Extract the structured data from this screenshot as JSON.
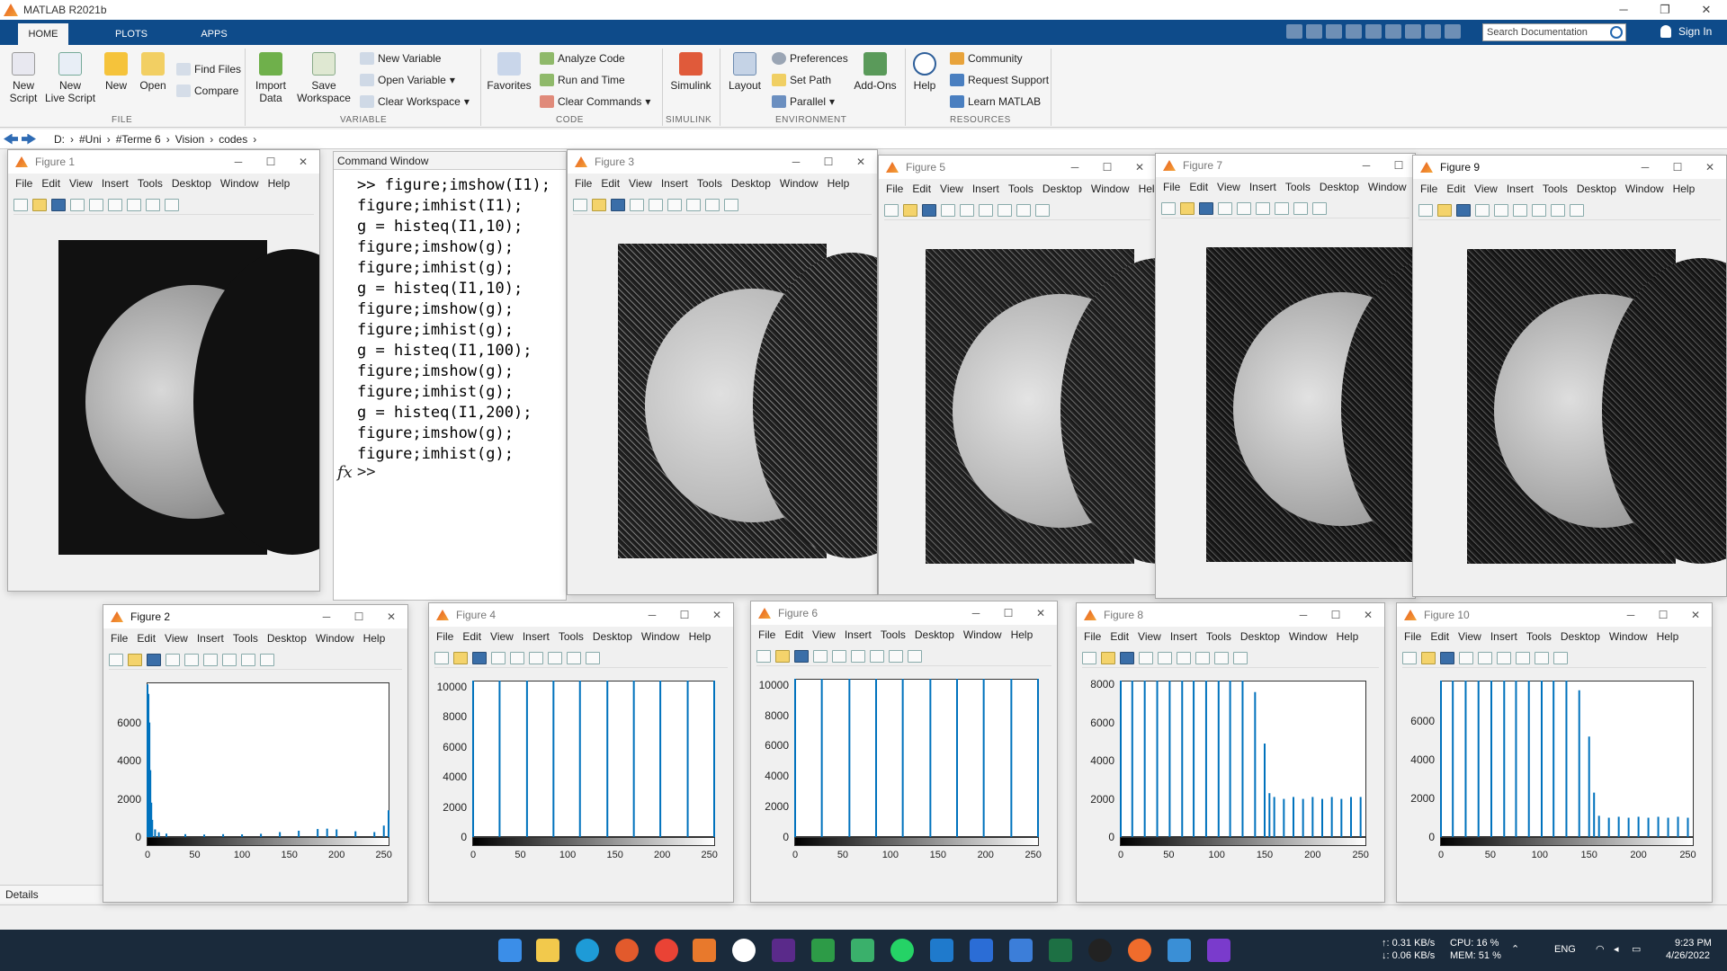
{
  "window": {
    "title": "MATLAB R2021b"
  },
  "tabs": [
    {
      "label": "HOME"
    },
    {
      "label": "PLOTS"
    },
    {
      "label": "APPS"
    }
  ],
  "search": {
    "placeholder": "Search Documentation"
  },
  "account": {
    "label": "Sign In"
  },
  "ribbon": {
    "file": {
      "label": "FILE",
      "new_script": "New\nScript",
      "new_live_script": "New\nLive Script",
      "new": "New",
      "open": "Open",
      "find_files": "Find Files",
      "compare": "Compare"
    },
    "variable": {
      "label": "VARIABLE",
      "import_data": "Import\nData",
      "save_workspace": "Save\nWorkspace",
      "new_variable": "New Variable",
      "open_variable": "Open Variable",
      "clear_workspace": "Clear Workspace"
    },
    "code": {
      "label": "CODE",
      "favorites": "Favorites",
      "analyze_code": "Analyze Code",
      "run_and_time": "Run and Time",
      "clear_commands": "Clear Commands"
    },
    "simulink": {
      "label": "SIMULINK",
      "simulink": "Simulink"
    },
    "environment": {
      "label": "ENVIRONMENT",
      "layout": "Layout",
      "preferences": "Preferences",
      "set_path": "Set Path",
      "parallel": "Parallel",
      "add_ons": "Add-Ons"
    },
    "resources": {
      "label": "RESOURCES",
      "help": "Help",
      "community": "Community",
      "request_support": "Request Support",
      "learn_matlab": "Learn MATLAB"
    }
  },
  "path": [
    "D:",
    "#Uni",
    "#Terme 6",
    "Vision",
    "codes"
  ],
  "command_window": {
    "title": "Command Window",
    "lines": [
      ">> figure;imshow(I1);",
      "figure;imhist(I1);",
      "g = histeq(I1,10);",
      "figure;imshow(g);",
      "figure;imhist(g);",
      "g = histeq(I1,10);",
      "figure;imshow(g);",
      "figure;imhist(g);",
      "g = histeq(I1,100);",
      "figure;imshow(g);",
      "figure;imhist(g);",
      "g = histeq(I1,200);",
      "figure;imshow(g);",
      "figure;imhist(g);"
    ],
    "fx": "fx",
    "prompt": ">>"
  },
  "details": {
    "label": "Details"
  },
  "figure_menu": [
    "File",
    "Edit",
    "View",
    "Insert",
    "Tools",
    "Desktop",
    "Window",
    "Help"
  ],
  "figures": {
    "fig1": {
      "title": "Figure 1"
    },
    "fig3": {
      "title": "Figure 3"
    },
    "fig5": {
      "title": "Figure 5"
    },
    "fig7": {
      "title": "Figure 7"
    },
    "fig9": {
      "title": "Figure 9"
    },
    "fig2": {
      "title": "Figure 2"
    },
    "fig4": {
      "title": "Figure 4"
    },
    "fig6": {
      "title": "Figure 6"
    },
    "fig8": {
      "title": "Figure 8"
    },
    "fig10": {
      "title": "Figure 10"
    }
  },
  "chart_data": [
    {
      "figure": "Figure 2",
      "type": "bar",
      "description_kind": "histogram",
      "x_ticks": [
        0,
        50,
        100,
        150,
        200,
        250
      ],
      "y_ticks": [
        0,
        2000,
        4000,
        6000
      ],
      "xlim": [
        0,
        255
      ],
      "ylim": [
        0,
        8100
      ],
      "x": [
        0,
        1,
        2,
        3,
        4,
        5,
        8,
        12,
        20,
        40,
        60,
        80,
        100,
        120,
        140,
        160,
        180,
        190,
        200,
        220,
        240,
        250,
        255
      ],
      "values": [
        8000,
        7500,
        6000,
        3500,
        1800,
        900,
        400,
        250,
        180,
        150,
        130,
        150,
        140,
        170,
        260,
        330,
        420,
        440,
        400,
        300,
        260,
        600,
        1400
      ],
      "color": "#0072bd"
    },
    {
      "figure": "Figure 4",
      "type": "bar",
      "description_kind": "histogram",
      "x_ticks": [
        0,
        50,
        100,
        150,
        200,
        250
      ],
      "y_ticks": [
        0,
        2000,
        4000,
        6000,
        8000,
        10000
      ],
      "xlim": [
        0,
        255
      ],
      "ylim": [
        0,
        10400
      ],
      "x": [
        0,
        28,
        57,
        85,
        113,
        142,
        170,
        198,
        227,
        255
      ],
      "values": [
        10400,
        10400,
        10400,
        10400,
        10400,
        10400,
        10400,
        10400,
        10400,
        10400
      ],
      "color": "#0072bd"
    },
    {
      "figure": "Figure 6",
      "type": "bar",
      "description_kind": "histogram",
      "x_ticks": [
        0,
        50,
        100,
        150,
        200,
        250
      ],
      "y_ticks": [
        0,
        2000,
        4000,
        6000,
        8000,
        10000
      ],
      "xlim": [
        0,
        255
      ],
      "ylim": [
        0,
        10400
      ],
      "x": [
        0,
        28,
        57,
        85,
        113,
        142,
        170,
        198,
        227,
        255
      ],
      "values": [
        10400,
        10400,
        10400,
        10400,
        10400,
        10400,
        10400,
        10400,
        10400,
        10400
      ],
      "color": "#0072bd"
    },
    {
      "figure": "Figure 8",
      "type": "bar",
      "description_kind": "histogram",
      "x_ticks": [
        0,
        50,
        100,
        150,
        200,
        250
      ],
      "y_ticks": [
        0,
        2000,
        4000,
        6000,
        8000
      ],
      "xlim": [
        0,
        255
      ],
      "ylim": [
        0,
        8200
      ],
      "x": [
        0,
        12,
        25,
        38,
        51,
        64,
        76,
        89,
        102,
        114,
        127,
        140,
        150,
        155,
        160,
        170,
        180,
        190,
        200,
        210,
        220,
        230,
        240,
        250
      ],
      "values": [
        8200,
        8200,
        8200,
        8200,
        8200,
        8200,
        8200,
        8200,
        8200,
        8200,
        8200,
        7600,
        4900,
        2300,
        2100,
        2000,
        2100,
        2000,
        2100,
        2000,
        2100,
        2000,
        2100,
        2100
      ],
      "color": "#0072bd"
    },
    {
      "figure": "Figure 10",
      "type": "bar",
      "description_kind": "histogram",
      "x_ticks": [
        0,
        50,
        100,
        150,
        200,
        250
      ],
      "y_ticks": [
        0,
        2000,
        4000,
        6000
      ],
      "xlim": [
        0,
        255
      ],
      "ylim": [
        0,
        8100
      ],
      "x": [
        0,
        12,
        25,
        38,
        51,
        64,
        76,
        89,
        102,
        114,
        127,
        140,
        150,
        155,
        160,
        170,
        180,
        190,
        200,
        210,
        220,
        230,
        240,
        250
      ],
      "values": [
        8100,
        8100,
        8100,
        8100,
        8100,
        8100,
        8100,
        8100,
        8100,
        8100,
        8100,
        7600,
        5200,
        2300,
        1100,
        1000,
        1050,
        1000,
        1050,
        1000,
        1050,
        1000,
        1050,
        1000
      ],
      "color": "#0072bd"
    }
  ],
  "taskbar": {
    "net_up": "↑: 0.31 KB/s",
    "net_down": "↓: 0.06 KB/s",
    "cpu": "CPU: 16 %",
    "mem": "MEM: 51 %",
    "lang": "ENG",
    "time": "9:23 PM",
    "date": "4/26/2022"
  }
}
